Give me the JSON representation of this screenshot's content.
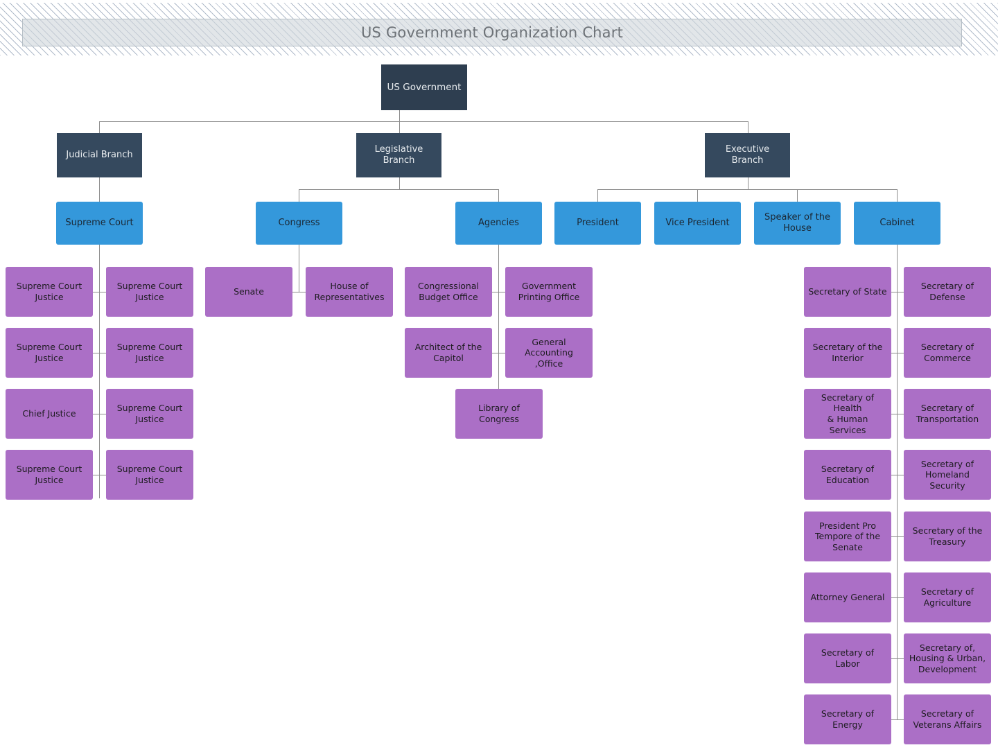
{
  "header": {
    "title": "US Government Organization Chart",
    "banner_color": "#d0d6db",
    "title_color": "#6d7277"
  },
  "palette": {
    "root": "#2e3e50",
    "branch": "#35495e",
    "blue": "#3498db",
    "purple": "#ab6fc6",
    "connector": "#8c8c8c"
  },
  "chart_data": {
    "type": "org-chart",
    "title": "US Government Organization Chart",
    "root": "US Government",
    "levels": [
      "root",
      "branch",
      "unit",
      "member"
    ],
    "nodes": {
      "root": {
        "label": "US Government"
      },
      "branches": [
        {
          "label": "Judicial Branch"
        },
        {
          "label": "Legislative Branch"
        },
        {
          "label": "Executive Branch"
        }
      ],
      "units": [
        {
          "label": "Supreme Court",
          "parent": "Judicial Branch"
        },
        {
          "label": "Congress",
          "parent": "Legislative Branch"
        },
        {
          "label": "Agencies",
          "parent": "Legislative Branch"
        },
        {
          "label": "President",
          "parent": "Executive Branch"
        },
        {
          "label": "Vice President",
          "parent": "Executive Branch"
        },
        {
          "label": "Speaker of the\nHouse",
          "parent": "Executive Branch"
        },
        {
          "label": "Cabinet",
          "parent": "Executive Branch"
        }
      ],
      "supreme_court_members": [
        "Supreme Court\nJustice",
        "Supreme Court\nJustice",
        "Supreme Court\nJustice",
        "Supreme Court\nJustice",
        "Chief Justice",
        "Supreme Court\nJustice",
        "Supreme Court\nJustice",
        "Supreme Court\nJustice"
      ],
      "congress_members": [
        "Senate",
        "House of\nRepresentatives"
      ],
      "agency_members": [
        "Congressional\nBudget Office",
        "Government\nPrinting Office",
        "Architect of the\nCapitol",
        "General\nAccounting ,Office",
        "Library of Congress"
      ],
      "cabinet_members": [
        "Secretary of State",
        "Secretary of\nDefense",
        "Secretary of the\nInterior",
        "Secretary of\nCommerce",
        "Secretary of Health\n& Human Services",
        "Secretary of\nTransportation",
        "Secretary of\nEducation",
        "Secretary of\nHomeland Security",
        "President Pro\nTempore of the\nSenate",
        "Secretary of the\nTreasury",
        "Attorney General",
        "Secretary of\nAgriculture",
        "Secretary of Labor",
        "Secretary of,\nHousing & Urban,\nDevelopment",
        "Secretary of Energy",
        "Secretary of\nVeterans Affairs"
      ]
    }
  }
}
